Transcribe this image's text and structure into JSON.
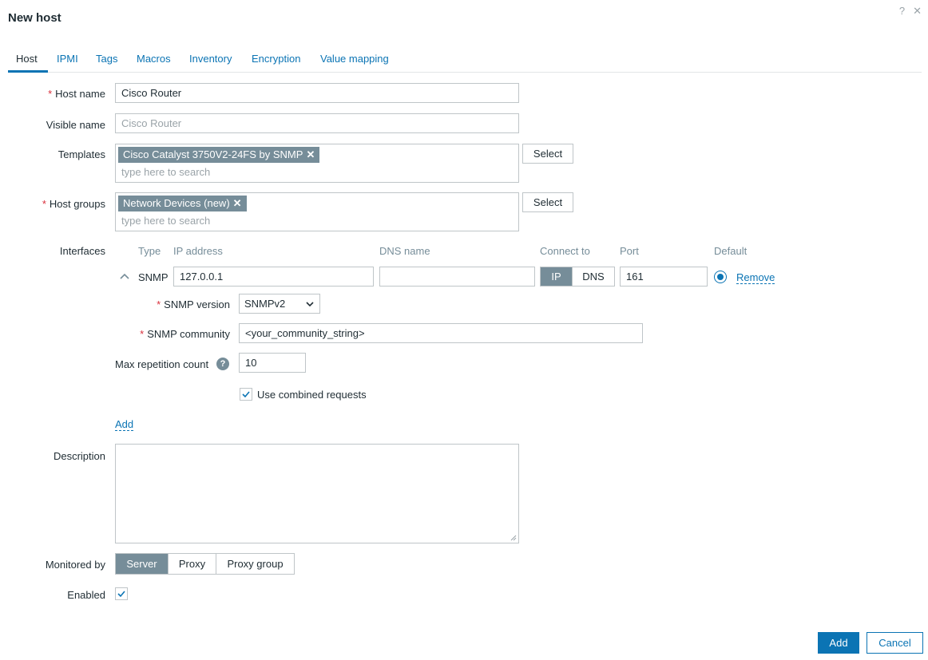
{
  "dialog": {
    "title": "New host",
    "help_glyph": "?",
    "close_glyph": "✕"
  },
  "tabs": [
    {
      "label": "Host"
    },
    {
      "label": "IPMI"
    },
    {
      "label": "Tags"
    },
    {
      "label": "Macros"
    },
    {
      "label": "Inventory"
    },
    {
      "label": "Encryption"
    },
    {
      "label": "Value mapping"
    }
  ],
  "active_tab": "Host",
  "colors": {
    "accent": "#0b74b4",
    "chip": "#768d99",
    "required": "#d9303c",
    "border": "#bfc5c8"
  },
  "form": {
    "required_mark": "*",
    "host_name": {
      "label": "Host name",
      "value": "Cisco Router"
    },
    "visible_name": {
      "label": "Visible name",
      "placeholder": "Cisco Router"
    },
    "templates": {
      "label": "Templates",
      "chip": "Cisco Catalyst 3750V2-24FS by SNMP",
      "placeholder": "type here to search",
      "select_label": "Select"
    },
    "host_groups": {
      "label": "Host groups",
      "chip": "Network Devices (new)",
      "placeholder": "type here to search",
      "select_label": "Select"
    },
    "interfaces": {
      "label": "Interfaces",
      "headers": {
        "type": "Type",
        "ip": "IP address",
        "dns": "DNS name",
        "connect": "Connect to",
        "port": "Port",
        "default": "Default"
      },
      "row": {
        "type": "SNMP",
        "ip": "127.0.0.1",
        "dns": "",
        "connect_ip": "IP",
        "connect_dns": "DNS",
        "connect_selected": "IP",
        "port": "161",
        "default_selected": true,
        "remove_label": "Remove"
      },
      "snmp_version": {
        "label": "SNMP version",
        "value": "SNMPv2"
      },
      "snmp_community": {
        "label": "SNMP community",
        "value": "<your_community_string>"
      },
      "max_repetition": {
        "label": "Max repetition count",
        "value": "10",
        "help_glyph": "?"
      },
      "combined_requests": {
        "label": "Use combined requests",
        "checked": true
      },
      "add_label": "Add"
    },
    "description": {
      "label": "Description",
      "value": ""
    },
    "monitored_by": {
      "label": "Monitored by",
      "options": [
        "Server",
        "Proxy",
        "Proxy group"
      ],
      "selected": "Server"
    },
    "enabled": {
      "label": "Enabled",
      "checked": true
    }
  },
  "footer": {
    "add_label": "Add",
    "cancel_label": "Cancel"
  }
}
